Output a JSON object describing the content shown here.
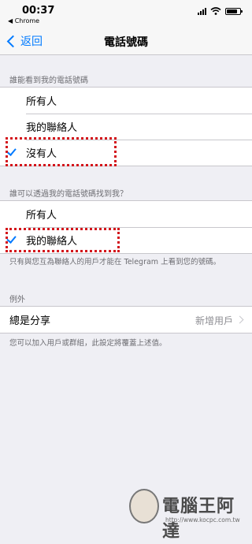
{
  "status": {
    "time": "00:37",
    "back_app": "◀ Chrome"
  },
  "nav": {
    "back_label": "返回",
    "title": "電話號碼"
  },
  "section1": {
    "header": "誰能看到我的電話號碼",
    "options": [
      "所有人",
      "我的聯絡人",
      "沒有人"
    ],
    "selected": "沒有人"
  },
  "section2": {
    "header": "誰可以透過我的電話號碼找到我？",
    "options": [
      "所有人",
      "我的聯絡人"
    ],
    "selected": "我的聯絡人",
    "footer": "只有與您互為聯絡人的用戶才能在 Telegram 上看到您的號碼。"
  },
  "exceptions": {
    "header": "例外",
    "row_label": "總是分享",
    "row_value": "新增用戶",
    "footer": "您可以加入用戶或群組，此設定將覆蓋上述值。"
  },
  "watermark": {
    "title": "電腦王阿達",
    "url": "http://www.kocpc.com.tw"
  },
  "colors": {
    "accent": "#007aff",
    "highlight": "#d3141b",
    "background": "#efeff4"
  }
}
